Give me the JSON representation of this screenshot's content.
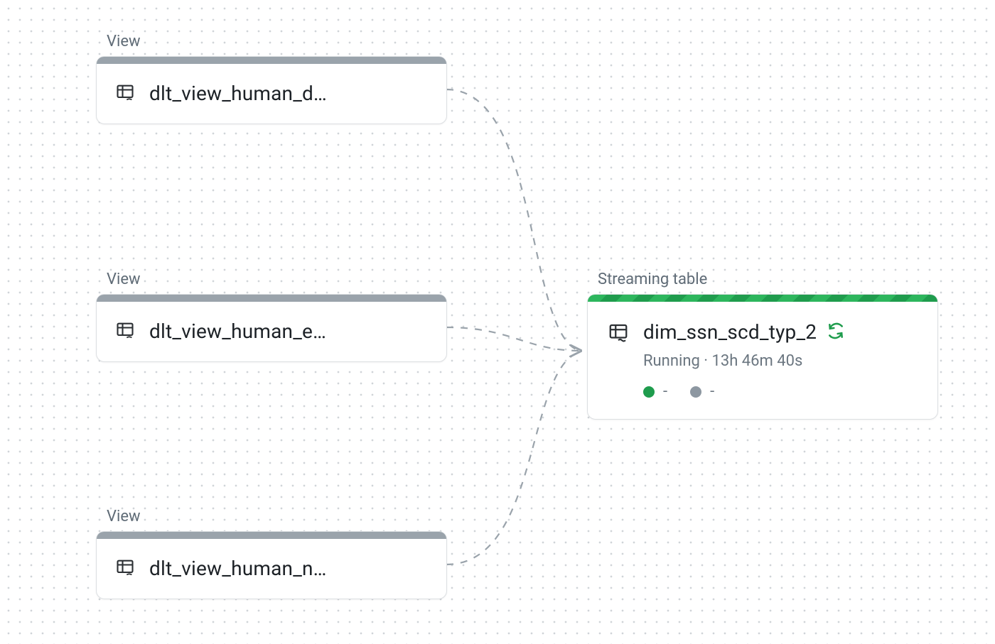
{
  "nodes": {
    "view1": {
      "type_label": "View",
      "name": "dlt_view_human_d…"
    },
    "view2": {
      "type_label": "View",
      "name": "dlt_view_human_e…"
    },
    "view3": {
      "type_label": "View",
      "name": "dlt_view_human_n…"
    },
    "target": {
      "type_label": "Streaming table",
      "name": "dim_ssn_scd_typ_2",
      "status_line": "Running · 13h 46m 40s",
      "stat_green": "-",
      "stat_gray": "-"
    }
  }
}
